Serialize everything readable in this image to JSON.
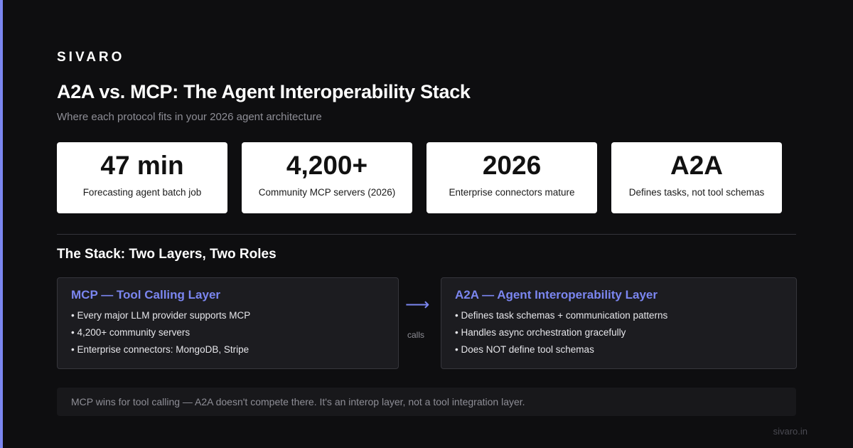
{
  "brand": "SIVARO",
  "title": "A2A vs. MCP: The Agent Interoperability Stack",
  "subtitle": "Where each protocol fits in your 2026 agent architecture",
  "stats": [
    {
      "value": "47 min",
      "label": "Forecasting agent batch job"
    },
    {
      "value": "4,200+",
      "label": "Community MCP servers (2026)"
    },
    {
      "value": "2026",
      "label": "Enterprise connectors mature"
    },
    {
      "value": "A2A",
      "label": "Defines tasks, not tool schemas"
    }
  ],
  "section_title": "The Stack: Two Layers, Two Roles",
  "mcp": {
    "heading": "MCP — Tool Calling Layer",
    "items": [
      "• Every major LLM provider supports MCP",
      "• 4,200+ community servers",
      "• Enterprise connectors: MongoDB, Stripe"
    ]
  },
  "connector": {
    "arrow": "⟶",
    "label": "calls"
  },
  "a2a": {
    "heading": "A2A — Agent Interoperability Layer",
    "items": [
      "• Defines task schemas + communication patterns",
      "• Handles async orchestration gracefully",
      "• Does NOT define tool schemas"
    ]
  },
  "note": "MCP wins for tool calling — A2A doesn't compete there. It's an interop layer, not a tool integration layer.",
  "footer": "sivaro.in",
  "colors": {
    "accent": "#7b86f0",
    "background": "#0e0e10",
    "card": "#ffffff"
  }
}
